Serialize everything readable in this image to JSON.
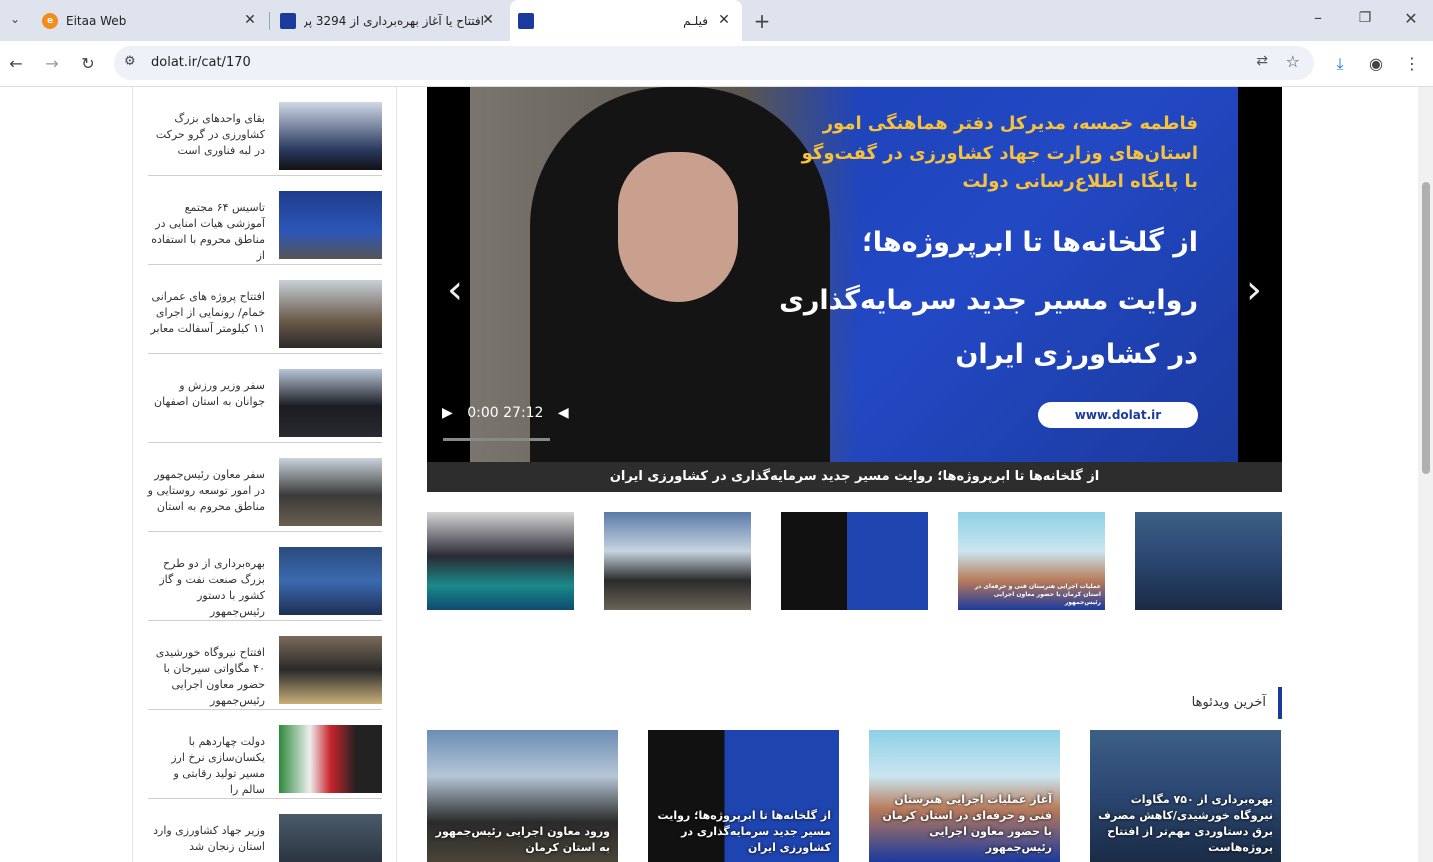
{
  "browser": {
    "tabs": [
      {
        "title": "Eitaa Web",
        "icon": "eitaa-icon"
      },
      {
        "title": "افتتاح یا آغاز بهره‌برداری از 3294 پر",
        "icon": "dolat-icon"
      },
      {
        "title": "فیلـم",
        "icon": "dolat-icon"
      }
    ],
    "url": "dolat.ir/cat/170"
  },
  "sidebar": {
    "items": [
      {
        "title": "بقای واحدهای بزرگ کشاورزی در گرو حرکت در لبه فناوری است"
      },
      {
        "title": "تاسیس ۶۴ مجتمع آموزشی هیات امنایی در مناطق محروم با استفاده از"
      },
      {
        "title": "افتتاح پروژه های عمرانی خمام/ رونمایی از اجرای ۱۱ کیلومتر آسفالت معابر"
      },
      {
        "title": "سفر وزیر ورزش و جوانان به استان اصفهان"
      },
      {
        "title": "سفر معاون رئیس‌جمهور در امور توسعه روستایی و مناطق محروم به استان"
      },
      {
        "title": "بهره‌برداری از دو طرح بزرگ صنعت نفت و گاز کشور با دستور رئیس‌جمهور"
      },
      {
        "title": "افتتاح نیروگاه خورشیدی ۴۰ مگاواتی سیرجان با حضور معاون اجرایی رئیس‌جمهور"
      },
      {
        "title": "دولت چهاردهم با یکسان‌سازی نرخ ارز مسیر تولید رقابتی و سالم را"
      },
      {
        "title": "وزیر جهاد کشاورزی وارد استان زنجان شد"
      }
    ]
  },
  "player": {
    "banner_lines": [
      "فاطمه خمسه، مدیرکل دفتر هماهنگی امور",
      "استان‌های وزارت جهاد کشاورزی در گفت‌وگو",
      "با پایگاه اطلاع‌رسانی دولت",
      "از گلخانه‌ها تا ابرپروژه‌ها؛",
      "روایت مسیر جدید سرمایه‌گذاری",
      "در کشاورزی ایران"
    ],
    "website": "www.dolat.ir",
    "time": "0:00 27:12",
    "progress": 0,
    "caption": "از گلخانه‌ها تا ابرپروژه‌ها؛ روایت مسیر جدید سرمایه‌گذاری در کشاورزی ایران"
  },
  "thumbnails": {
    "labels": [
      "",
      "",
      "",
      "عملیات اجرایی هنرستان فنی و حرفه‌ای در استان کرمان با حضور معاون اجرایی رئیس‌جمهور",
      ""
    ]
  },
  "latest": {
    "title": "آخرین ویدئوها",
    "videos": [
      {
        "title": "ورود معاون اجرایی رئیس‌جمهور به استان کرمان"
      },
      {
        "title": "از گلخانه‌ها تا ابرپروژه‌ها؛ روایت مسیر جدید سرمایه‌گذاری در کشاورزی ایران"
      },
      {
        "title": "آغاز عملیات اجرایی هنرستان فنی و حرفه‌ای در استان کرمان با حضور معاون اجرایی رئیس‌جمهور"
      },
      {
        "title": "بهره‌برداری از ۷۵۰ مگاوات نیروگاه خورشیدی/کاهش مصرف برق دستاوردی مهم‌تر از افتتاح پروژه‌هاست"
      }
    ]
  },
  "colors": {
    "accent": "#1b3a9e",
    "tabbar": "#dfe3ee"
  }
}
